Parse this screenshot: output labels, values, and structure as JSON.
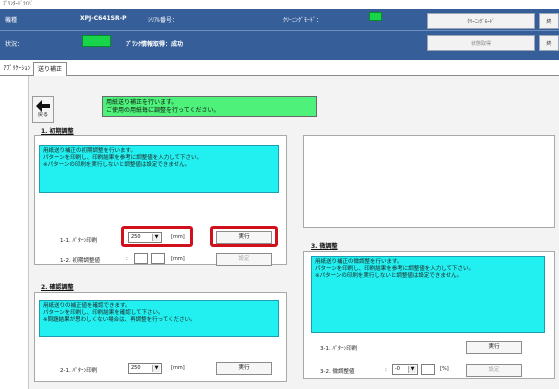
{
  "window": {
    "title": "ﾌﾟﾘﾝﾀｰﾄﾞﾗｲﾊﾞ"
  },
  "header": {
    "model_label": "機種",
    "model_value": "XPJ-C641SR-P",
    "serial_label": "ｼﾘｱﾙ番号：",
    "mode_label": "ｸﾘｰﾆﾝｸﾞﾓｰﾄﾞ：",
    "status_label": "状況：",
    "status_text": "ﾌﾟﾗﾝｸ情報取得：成功",
    "btn_cleaning_mode": "ｸﾘｰﾆﾝｸﾞﾓｰﾄﾞ",
    "btn_status": "状態取得",
    "btn_right_top": "終",
    "btn_right_bottom": "終"
  },
  "tabs": [
    {
      "label": "ｱﾌﾟﾘｹｰｼｮﾝ"
    },
    {
      "label": "送り補正"
    }
  ],
  "back_button": {
    "label": "戻る"
  },
  "message_bar": {
    "line1": "用紙送り補正を行います。",
    "line2": "ご使用の用紙毎に調整を行ってください。"
  },
  "section1": {
    "title": "1. 初期調整",
    "info": "用紙送り補正の初期調整を行います。\nパターンを印刷し、印刷結果を参考に調整値を入力して下さい。\n※パターンの印刷を実行しないと調整値は設定できません。",
    "row1_label": "1-1. ﾊﾟﾀｰﾝ印刷",
    "row1_select": "250",
    "row1_unit": "[mm]",
    "row1_button": "実行",
    "row2_label": "1-2. 初期調整値",
    "row2_colon": ":",
    "row2_unit": "[mm]",
    "row2_button": "設定"
  },
  "section2": {
    "title": "2. 確認調整",
    "info": "用紙送りの補正値を確認できます。\nパターンを印刷し、印刷結果を確認して下さい。\n※問題結果が思わしくない場合は、再調整を行ってください。",
    "row1_label": "2-1. ﾊﾟﾀｰﾝ印刷",
    "row1_select": "250",
    "row1_unit": "[mm]",
    "row1_button": "実行"
  },
  "section3": {
    "title": "3. 微調整",
    "info": "用紙送り補正の微調整を行います。\nパターンを印刷し、印刷結果を参考に調整値を入力して下さい。\n※パターンの印刷を実行しないと調整値は設定できません。",
    "row1_label": "3-1. ﾊﾟﾀｰﾝ印刷",
    "row1_button": "実行",
    "row2_label": "3-2. 微調整値",
    "row2_colon": ":",
    "row2_select": "-0",
    "row2_unit": "[%]",
    "row2_button": "設定"
  },
  "colors": {
    "header_blue": "#365f9a",
    "status_green": "#17d44a",
    "message_green": "#4ef27a",
    "info_cyan": "#22f0f0",
    "highlight_red": "#d0101c"
  }
}
